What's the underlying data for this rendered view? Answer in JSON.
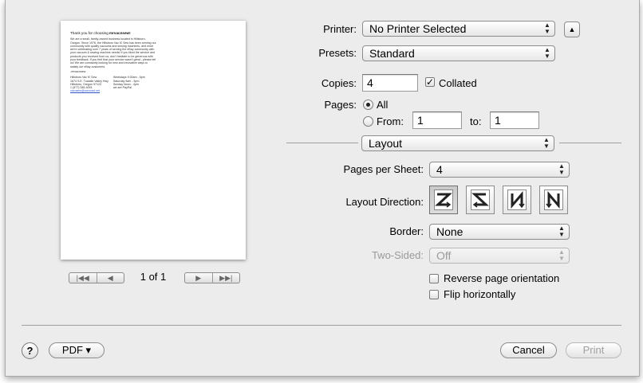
{
  "preview": {
    "heading": "Thank you for choosing",
    "brand": "mrvacnsew!",
    "para1": "We are a small, family-owned business located in Hillsboro, Oregon. Since 1976, the Hillsboro Vac N' Sew has been serving our community with quality vacuums and sewing machines, and more we're celebrating over 7 years of serving the eBay community with your vacuum & sewing machine needs! If you liked the service and products you received from us, don't hesitate to be generous with your feedback. If you feel that your service wasn't great - please tell us! We are constantly looking for new and innovative ways to satisfy our eBay customers.",
    "sign": "-mrvacnsew",
    "addr": [
      "Hillsboro Vac N' Sew",
      "1674 S.E. Tualatin Valley Hwy",
      "Hillsboro, Oregon 97123",
      "1 (877) 285-4091"
    ],
    "email": "vacnsew@comcast.net",
    "hours": [
      "Weekdays 9:30am - 6pm",
      "Saturday 9am - 5pm",
      "Sunday Noon - 4pm",
      "we are PayPal"
    ],
    "page_label": "1 of 1"
  },
  "printer": {
    "label": "Printer:",
    "value": "No Printer Selected",
    "disclosure": "▲"
  },
  "presets": {
    "label": "Presets:",
    "value": "Standard"
  },
  "copies": {
    "label": "Copies:",
    "value": "4",
    "collated_label": "Collated",
    "collated_checked": true
  },
  "pages": {
    "label": "Pages:",
    "all_label": "All",
    "from_label": "From:",
    "from_value": "1",
    "to_label": "to:",
    "to_value": "1"
  },
  "section": {
    "value": "Layout"
  },
  "layout": {
    "pages_per_sheet_label": "Pages per Sheet:",
    "pages_per_sheet_value": "4",
    "direction_label": "Layout Direction:",
    "border_label": "Border:",
    "border_value": "None",
    "two_sided_label": "Two-Sided:",
    "two_sided_value": "Off",
    "reverse_label": "Reverse page orientation",
    "flip_label": "Flip horizontally"
  },
  "footer": {
    "help": "?",
    "pdf": "PDF ▾",
    "cancel": "Cancel",
    "print": "Print"
  },
  "icons": {
    "check": "✓",
    "arrows": "▲▼"
  }
}
